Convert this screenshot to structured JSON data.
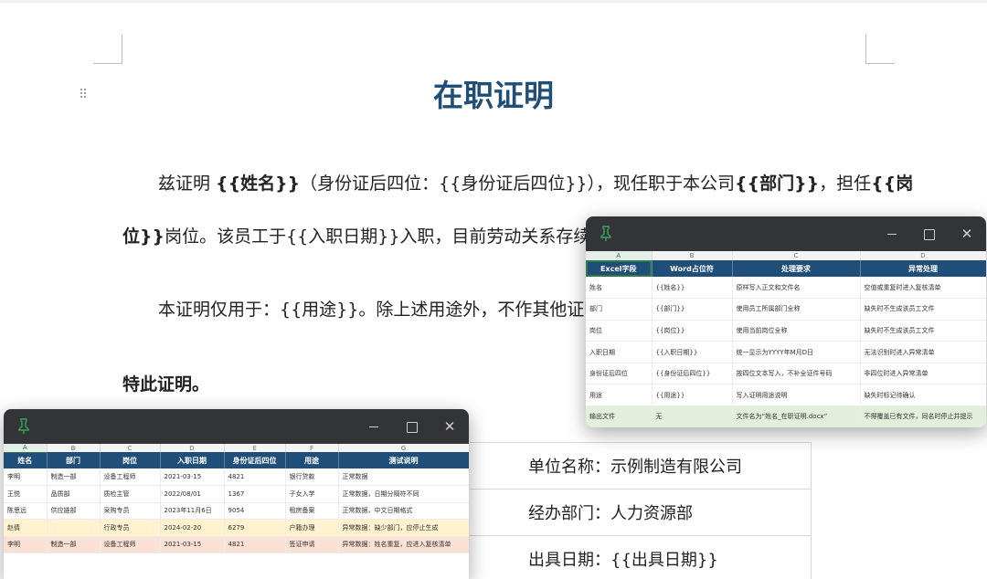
{
  "document": {
    "title": "在职证明",
    "para1": {
      "prefix": "兹证明 ",
      "name_ph": "{{姓名}}",
      "mid1": "（身份证后四位：{{身份证后四位}}），现任职于本公司",
      "dept_ph": "{{部门}}",
      "mid2": "，担任",
      "pos_ph_a": "{{岗",
      "pos_ph_b": "位}}",
      "line2": "岗位。该员工于{{入职日期}}入职，目前劳动关系存续，"
    },
    "para2": "本证明仅用于：{{用途}}。除上述用途外，不作其他证明",
    "para3": "特此证明。",
    "info": [
      "单位名称：示例制造有限公司",
      "经办部门：人力资源部",
      "出具日期：{{出具日期}}"
    ]
  },
  "window_right": {
    "col_letters": [
      "A",
      "B",
      "C",
      "D"
    ],
    "headers": [
      "Excel字段",
      "Word占位符",
      "处理要求",
      "异常处理"
    ],
    "rows": [
      [
        "姓名",
        "{{姓名}}",
        "原样写入正文和文件名",
        "空值或重复时进入复核清单"
      ],
      [
        "部门",
        "{{部门}}",
        "使用员工所属部门全称",
        "缺失时不生成该员工文件"
      ],
      [
        "岗位",
        "{{岗位}}",
        "使用当前岗位全称",
        "缺失时不生成该员工文件"
      ],
      [
        "入职日期",
        "{{入职日期}}",
        "统一显示为YYYY年M月D日",
        "无法识别时进入异常清单"
      ],
      [
        "身份证后四位",
        "{{身份证后四位}}",
        "按四位文本写入，不补全证件号码",
        "非四位时进入异常清单"
      ],
      [
        "用途",
        "{{用途}}",
        "写入证明用途说明",
        "缺失时标记待确认"
      ],
      [
        "输出文件",
        "无",
        "文件名为“姓名_在职证明.docx”",
        "不得覆盖已有文件，同名时停止并提示"
      ]
    ]
  },
  "window_left": {
    "col_letters": [
      "A",
      "B",
      "C",
      "D",
      "E",
      "F",
      "G"
    ],
    "headers": [
      "姓名",
      "部门",
      "岗位",
      "入职日期",
      "身份证后四位",
      "用途",
      "测试说明"
    ],
    "rows": [
      [
        "李明",
        "制造一部",
        "设备工程师",
        "2021-03-15",
        "4821",
        "银行贷款",
        "正常数据"
      ],
      [
        "王悦",
        "品质部",
        "质检主管",
        "2022/08/01",
        "1367",
        "子女入学",
        "正常数据，日期分隔符不同"
      ],
      [
        "陈思远",
        "供应链部",
        "采购专员",
        "2023年11月6日",
        "9054",
        "租房备案",
        "正常数据，中文日期格式"
      ],
      [
        "赵倩",
        "",
        "行政专员",
        "2024-02-20",
        "6279",
        "户籍办理",
        "异常数据：缺少部门，应停止生成"
      ],
      [
        "李明",
        "制造一部",
        "设备工程师",
        "2021-03-15",
        "4821",
        "签证申请",
        "异常数据：姓名重复，应进入复核清单"
      ]
    ]
  },
  "colors": {
    "title": "#1f4e79",
    "table_header": "#1f4e79",
    "highlight_green": "#e2efda",
    "highlight_yellow": "#fff2cc",
    "highlight_pink": "#fbe0d6",
    "titlebar": "#333437"
  },
  "icons": [
    "pin-icon",
    "minimize-icon",
    "maximize-icon",
    "close-icon",
    "drag-handle-icon"
  ]
}
